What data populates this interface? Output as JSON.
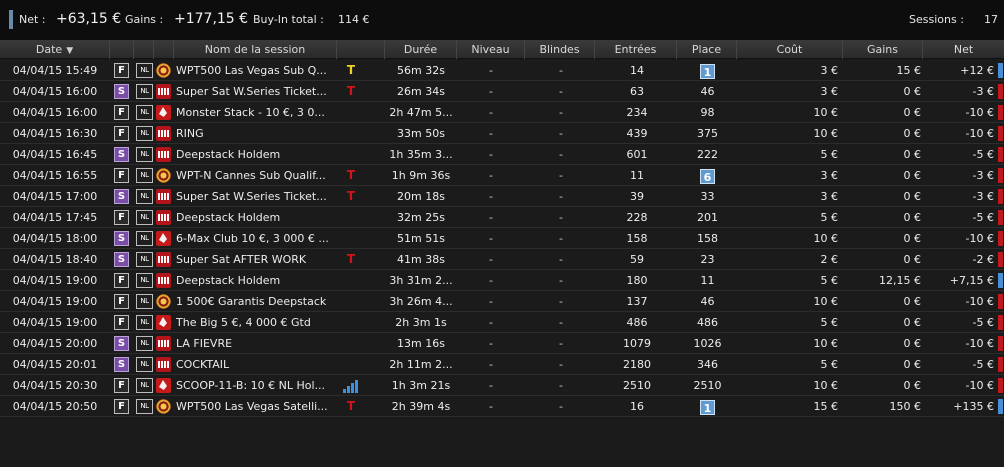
{
  "summary": {
    "net_label": "Net :",
    "net_value": "+63,15 €",
    "gains_label": "Gains :",
    "gains_value": "+177,15 €",
    "buyin_label": "Buy-In total :",
    "buyin_value": "114 €",
    "sessions_label": "Sessions :",
    "sessions_value": "17"
  },
  "columns": {
    "date": "Date",
    "name": "Nom de la session",
    "duration": "Durée",
    "level": "Niveau",
    "blinds": "Blindes",
    "entries": "Entrées",
    "place": "Place",
    "cost": "Coût",
    "gains": "Gains",
    "net": "Net"
  },
  "colors": {
    "positive": "#4a8fd6",
    "negative": "#c0181c",
    "sng": "#7a4ea8",
    "highlight_place": "#5f9bd0"
  },
  "rows": [
    {
      "date": "04/04/15 15:49",
      "type": "F",
      "game": "NL",
      "room": "wpt-icon",
      "name": "WPT500 Las Vegas Sub Q...",
      "extra": "T",
      "extra_icon": "ticket-yellow-icon",
      "duration": "56m 32s",
      "level": "-",
      "blinds": "-",
      "entries": "14",
      "place": "1",
      "place_highlight": true,
      "cost": "3 €",
      "gains": "15 €",
      "net": "+12 €",
      "net_sign": "pos"
    },
    {
      "date": "04/04/15 16:00",
      "type": "S",
      "game": "NL",
      "room": "unibet-icon",
      "name": "Super Sat W.Series Ticket...",
      "extra": "T",
      "extra_icon": "ticket-red-icon",
      "duration": "26m 34s",
      "level": "-",
      "blinds": "-",
      "entries": "63",
      "place": "46",
      "place_highlight": false,
      "cost": "3 €",
      "gains": "0 €",
      "net": "-3 €",
      "net_sign": "neg"
    },
    {
      "date": "04/04/15 16:00",
      "type": "F",
      "game": "NL",
      "room": "pmu-icon",
      "name": "Monster Stack - 10 €, 3 0...",
      "extra": "",
      "extra_icon": "",
      "duration": "2h 47m 5...",
      "level": "-",
      "blinds": "-",
      "entries": "234",
      "place": "98",
      "place_highlight": false,
      "cost": "10 €",
      "gains": "0 €",
      "net": "-10 €",
      "net_sign": "neg"
    },
    {
      "date": "04/04/15 16:30",
      "type": "F",
      "game": "NL",
      "room": "unibet-icon",
      "name": "RING",
      "extra": "",
      "extra_icon": "",
      "duration": "33m 50s",
      "level": "-",
      "blinds": "-",
      "entries": "439",
      "place": "375",
      "place_highlight": false,
      "cost": "10 €",
      "gains": "0 €",
      "net": "-10 €",
      "net_sign": "neg"
    },
    {
      "date": "04/04/15 16:45",
      "type": "S",
      "game": "NL",
      "room": "unibet-icon",
      "name": "Deepstack Holdem",
      "extra": "",
      "extra_icon": "",
      "duration": "1h 35m 3...",
      "level": "-",
      "blinds": "-",
      "entries": "601",
      "place": "222",
      "place_highlight": false,
      "cost": "5 €",
      "gains": "0 €",
      "net": "-5 €",
      "net_sign": "neg"
    },
    {
      "date": "04/04/15 16:55",
      "type": "F",
      "game": "NL",
      "room": "wpt-icon",
      "name": "WPT-N Cannes Sub Qualif...",
      "extra": "T",
      "extra_icon": "ticket-red-icon",
      "duration": "1h 9m 36s",
      "level": "-",
      "blinds": "-",
      "entries": "11",
      "place": "6",
      "place_highlight": true,
      "cost": "3 €",
      "gains": "0 €",
      "net": "-3 €",
      "net_sign": "neg"
    },
    {
      "date": "04/04/15 17:00",
      "type": "S",
      "game": "NL",
      "room": "unibet-icon",
      "name": "Super Sat W.Series Ticket...",
      "extra": "T",
      "extra_icon": "ticket-red-icon",
      "duration": "20m 18s",
      "level": "-",
      "blinds": "-",
      "entries": "39",
      "place": "33",
      "place_highlight": false,
      "cost": "3 €",
      "gains": "0 €",
      "net": "-3 €",
      "net_sign": "neg"
    },
    {
      "date": "04/04/15 17:45",
      "type": "F",
      "game": "NL",
      "room": "unibet-icon",
      "name": "Deepstack Holdem",
      "extra": "",
      "extra_icon": "",
      "duration": "32m 25s",
      "level": "-",
      "blinds": "-",
      "entries": "228",
      "place": "201",
      "place_highlight": false,
      "cost": "5 €",
      "gains": "0 €",
      "net": "-5 €",
      "net_sign": "neg"
    },
    {
      "date": "04/04/15 18:00",
      "type": "S",
      "game": "NL",
      "room": "pmu-icon",
      "name": "6-Max Club 10 €, 3 000 € ...",
      "extra": "",
      "extra_icon": "",
      "duration": "51m 51s",
      "level": "-",
      "blinds": "-",
      "entries": "158",
      "place": "158",
      "place_highlight": false,
      "cost": "10 €",
      "gains": "0 €",
      "net": "-10 €",
      "net_sign": "neg"
    },
    {
      "date": "04/04/15 18:40",
      "type": "S",
      "game": "NL",
      "room": "unibet-icon",
      "name": "Super Sat AFTER WORK",
      "extra": "T",
      "extra_icon": "ticket-red-icon",
      "duration": "41m 38s",
      "level": "-",
      "blinds": "-",
      "entries": "59",
      "place": "23",
      "place_highlight": false,
      "cost": "2 €",
      "gains": "0 €",
      "net": "-2 €",
      "net_sign": "neg"
    },
    {
      "date": "04/04/15 19:00",
      "type": "F",
      "game": "NL",
      "room": "unibet-icon",
      "name": "Deepstack Holdem",
      "extra": "",
      "extra_icon": "",
      "duration": "3h 31m 2...",
      "level": "-",
      "blinds": "-",
      "entries": "180",
      "place": "11",
      "place_highlight": false,
      "cost": "5 €",
      "gains": "12,15 €",
      "net": "+7,15 €",
      "net_sign": "pos"
    },
    {
      "date": "04/04/15 19:00",
      "type": "F",
      "game": "NL",
      "room": "wpt-icon",
      "name": "1 500€ Garantis Deepstack",
      "extra": "",
      "extra_icon": "",
      "duration": "3h 26m 4...",
      "level": "-",
      "blinds": "-",
      "entries": "137",
      "place": "46",
      "place_highlight": false,
      "cost": "10 €",
      "gains": "0 €",
      "net": "-10 €",
      "net_sign": "neg"
    },
    {
      "date": "04/04/15 19:00",
      "type": "F",
      "game": "NL",
      "room": "pmu-icon",
      "name": "The Big 5 €, 4 000 € Gtd",
      "extra": "",
      "extra_icon": "",
      "duration": "2h 3m 1s",
      "level": "-",
      "blinds": "-",
      "entries": "486",
      "place": "486",
      "place_highlight": false,
      "cost": "5 €",
      "gains": "0 €",
      "net": "-5 €",
      "net_sign": "neg"
    },
    {
      "date": "04/04/15 20:00",
      "type": "S",
      "game": "NL",
      "room": "unibet-icon",
      "name": "LA FIEVRE",
      "extra": "",
      "extra_icon": "",
      "duration": "13m 16s",
      "level": "-",
      "blinds": "-",
      "entries": "1079",
      "place": "1026",
      "place_highlight": false,
      "cost": "10 €",
      "gains": "0 €",
      "net": "-10 €",
      "net_sign": "neg"
    },
    {
      "date": "04/04/15 20:01",
      "type": "S",
      "game": "NL",
      "room": "unibet-icon",
      "name": "COCKTAIL",
      "extra": "",
      "extra_icon": "",
      "duration": "2h 11m 2...",
      "level": "-",
      "blinds": "-",
      "entries": "2180",
      "place": "346",
      "place_highlight": false,
      "cost": "5 €",
      "gains": "0 €",
      "net": "-5 €",
      "net_sign": "neg"
    },
    {
      "date": "04/04/15 20:30",
      "type": "F",
      "game": "NL",
      "room": "pmu-icon",
      "name": "SCOOP-11-B:  10 € NL Hol...",
      "extra": "",
      "extra_icon": "signal-bars-icon",
      "duration": "1h 3m 21s",
      "level": "-",
      "blinds": "-",
      "entries": "2510",
      "place": "2510",
      "place_highlight": false,
      "cost": "10 €",
      "gains": "0 €",
      "net": "-10 €",
      "net_sign": "neg"
    },
    {
      "date": "04/04/15 20:50",
      "type": "F",
      "game": "NL",
      "room": "wpt-icon",
      "name": "WPT500 Las Vegas Satelli...",
      "extra": "T",
      "extra_icon": "ticket-red-icon",
      "duration": "2h 39m 4s",
      "level": "-",
      "blinds": "-",
      "entries": "16",
      "place": "1",
      "place_highlight": true,
      "cost": "15 €",
      "gains": "150 €",
      "net": "+135 €",
      "net_sign": "pos"
    }
  ]
}
